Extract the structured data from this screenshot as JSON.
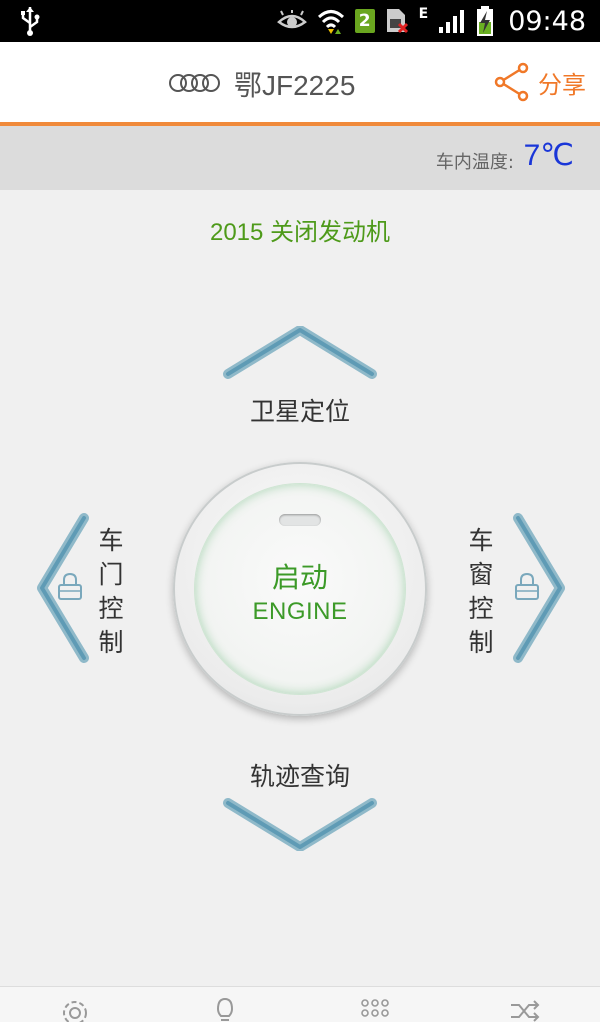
{
  "status_bar": {
    "time": "09:48",
    "sim_slot": "2",
    "network_type": "E"
  },
  "header": {
    "plate": "鄂JF2225",
    "share_label": "分享"
  },
  "temperature": {
    "label": "车内温度:",
    "value": "7℃"
  },
  "main": {
    "status_text": "2015 关闭发动机",
    "up_label": "卫星定位",
    "down_label": "轨迹查询",
    "left_label": [
      "车",
      "门",
      "控",
      "制"
    ],
    "right_label": [
      "车",
      "窗",
      "控",
      "制"
    ],
    "engine_label": "启动",
    "engine_sub": "ENGINE"
  },
  "bottom_nav": {
    "icons": [
      "gear-icon",
      "bulb-icon",
      "grid-icon",
      "shuffle-icon"
    ]
  },
  "colors": {
    "accent": "#f07828",
    "status_green": "#4e9a1a",
    "temp_blue": "#1a36d8",
    "arrow_blue": "#5f9bb5"
  }
}
